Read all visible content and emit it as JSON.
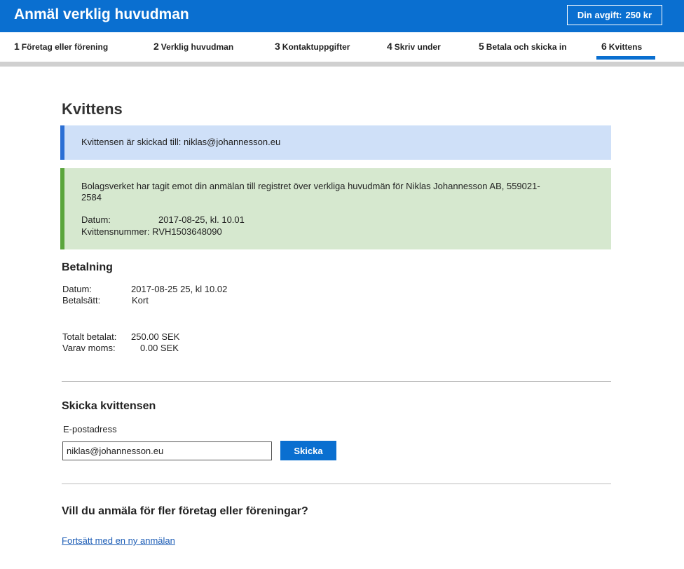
{
  "header": {
    "title": "Anmäl verklig huvudman",
    "fee_label": "Din avgift:",
    "fee_value": "250 kr"
  },
  "steps": [
    {
      "num": "1",
      "label": "Företag eller förening"
    },
    {
      "num": "2",
      "label": "Verklig huvudman"
    },
    {
      "num": "3",
      "label": "Kontaktuppgifter"
    },
    {
      "num": "4",
      "label": "Skriv under"
    },
    {
      "num": "5",
      "label": "Betala och skicka in"
    },
    {
      "num": "6",
      "label": "Kvittens"
    }
  ],
  "active_step": "6",
  "page_title": "Kvittens",
  "info": {
    "text": "Kvittensen är skickad till: niklas@johannesson.eu"
  },
  "success": {
    "message": "Bolagsverket har tagit emot din anmälan till registret över verkliga huvudmän för Niklas Johannesson AB, 559021-2584",
    "date_label": "Datum:",
    "date_value": "2017-08-25, kl. 10.01",
    "receipt_label": "Kvittensnummer:",
    "receipt_value": "RVH1503648090"
  },
  "payment": {
    "heading": "Betalning",
    "date_label": "Datum:",
    "date_value": "2017-08-25 25, kl 10.02",
    "method_label": "Betalsätt:",
    "method_value": "Kort",
    "total_label": "Totalt betalat:",
    "total_value": "250.00 SEK",
    "vat_label": "Varav moms:",
    "vat_value": "0.00 SEK"
  },
  "send_receipt": {
    "heading": "Skicka kvittensen",
    "email_label": "E-postadress",
    "email_value": "niklas@johannesson.eu",
    "button_label": "Skicka"
  },
  "more": {
    "question": "Vill du anmäla för fler företag eller föreningar?",
    "link_label": "Fortsätt med en ny anmälan"
  },
  "colors": {
    "brand_blue": "#0a6fd0",
    "info_bg": "#cfe0f8",
    "info_accent": "#2b6fd4",
    "success_bg": "#d6e8cf",
    "success_accent": "#5aa53c"
  }
}
